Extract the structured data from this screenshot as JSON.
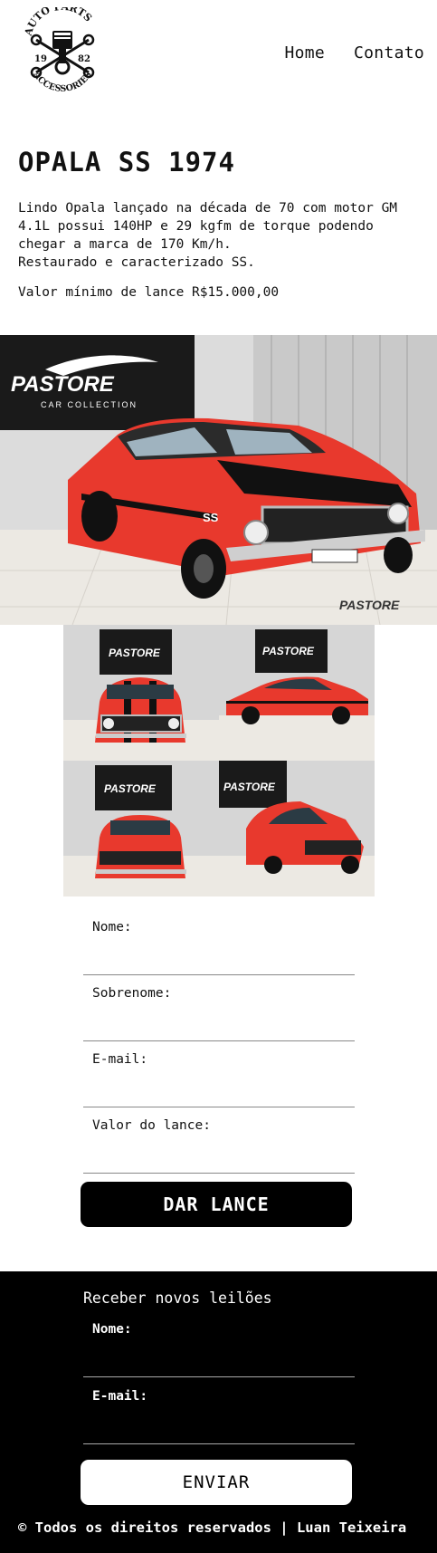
{
  "logo": {
    "top_text": "AUTO PARTS",
    "bottom_text": "ACCESSORIES",
    "year_left": "19",
    "year_right": "82",
    "icon": "piston-wrench-icon"
  },
  "nav": {
    "items": [
      "Home",
      "Contato"
    ]
  },
  "product": {
    "title": "OPALA SS 1974",
    "description": "Lindo Opala lançado na década de 70 com motor GM\n4.1L possui 140HP e 29 kgfm de torque podendo\nchegar a marca de 170 Km/h.\nRestaurado e caracterizado SS.",
    "min_bid": "Valor mínimo de lance R$15.000,00"
  },
  "gallery": {
    "brand": "PASTORE",
    "brand_sub": "CAR COLLECTION",
    "badge": "SS",
    "colors": {
      "car": "#e8392d",
      "stripe": "#111111",
      "wall": "#d9d9d9",
      "floor": "#ece9e3",
      "banner": "#1a1a1a"
    }
  },
  "bid_form": {
    "fields": [
      "Nome:",
      "Sobrenome:",
      "E-mail:",
      "Valor do lance:"
    ],
    "submit": "DAR LANCE"
  },
  "footer": {
    "title": "Receber novos leilões",
    "fields": [
      "Nome:",
      "E-mail:"
    ],
    "submit": "ENVIAR",
    "copyright": "© Todos os direitos reservados | Luan Teixeira"
  }
}
